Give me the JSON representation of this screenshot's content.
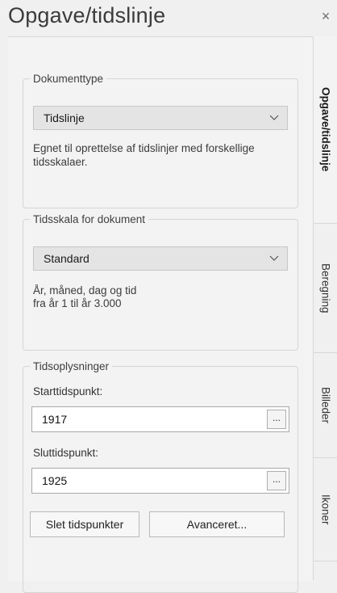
{
  "pane": {
    "title": "Opgave/tidslinje",
    "close_glyph": "×"
  },
  "document_type": {
    "legend": "Dokumenttype",
    "selected": "Tidslinje",
    "description": "Egnet til oprettelse af tidslinjer med forskellige tidsskalaer."
  },
  "time_scale": {
    "legend": "Tidsskala for dokument",
    "selected": "Standard",
    "description_line1": "År, måned, dag og tid",
    "description_line2": "fra år 1 til år 3.000"
  },
  "time_info": {
    "legend": "Tidsoplysninger",
    "start_label": "Starttidspunkt:",
    "start_value": "1917",
    "end_label": "Sluttidspunkt:",
    "end_value": "1925",
    "ellipsis_label": "...",
    "clear_button": "Slet tidspunkter",
    "advanced_button": "Avanceret..."
  },
  "tabs": [
    {
      "label": "Opgave/tidslinje",
      "active": true
    },
    {
      "label": "Beregning",
      "active": false
    },
    {
      "label": "Billeder",
      "active": false
    },
    {
      "label": "Ikoner",
      "active": false
    }
  ],
  "icons": {
    "dropdown": "chevron-down-icon",
    "close": "close-icon"
  },
  "colors": {
    "background": "#f0f0f0",
    "select_bg": "#e4e4e4",
    "border": "#d5d5d5",
    "text": "#1e1e1e"
  }
}
